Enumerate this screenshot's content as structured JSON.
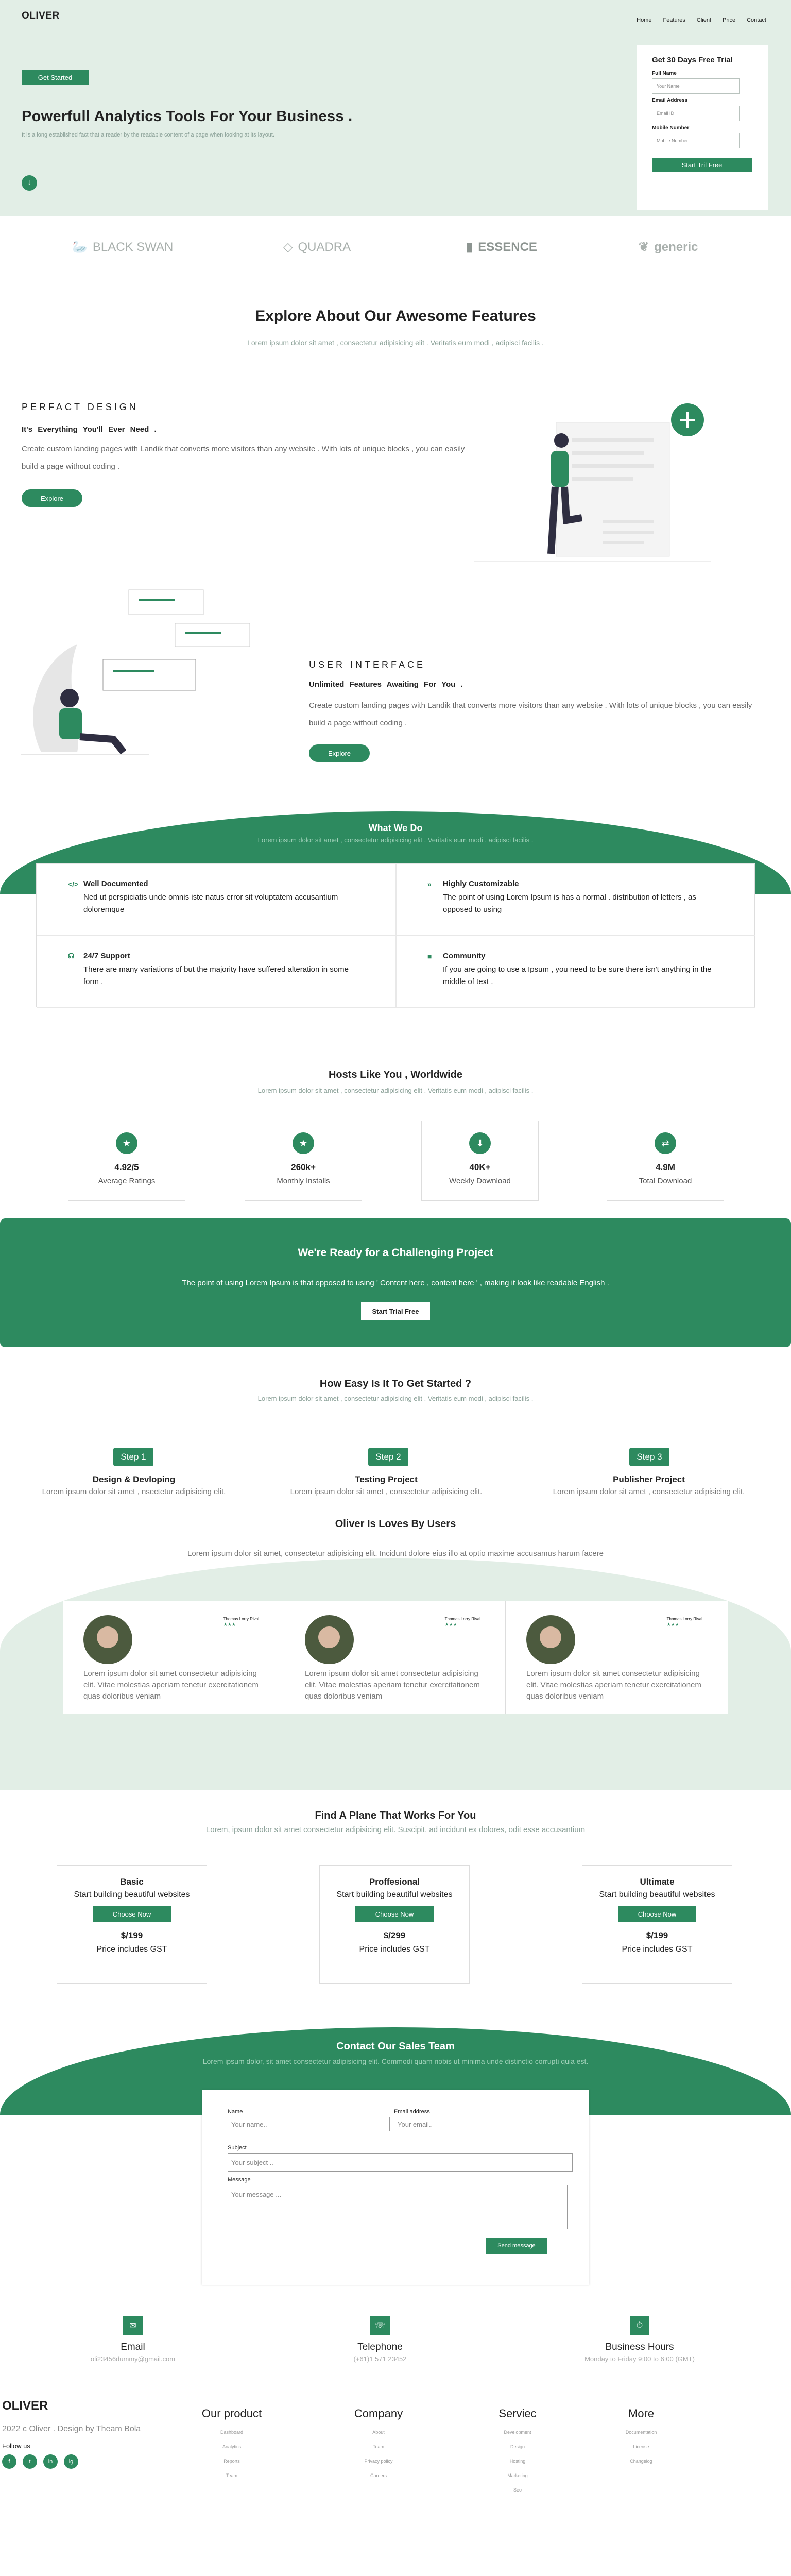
{
  "header": {
    "logo": "OLIVER",
    "nav": [
      "Home",
      "Features",
      "Client",
      "Price",
      "Contact"
    ]
  },
  "hero": {
    "cta": "Get Started",
    "title": "Powerfull Analytics Tools For Your Business .",
    "subtitle": "It is a long established fact that a reader by the readable content of a page when looking at its layout."
  },
  "trial": {
    "title": "Get 30 Days Free Trial",
    "name_label": "Full Name",
    "name_placeholder": "Your Name",
    "email_label": "Email Address",
    "email_placeholder": "Email ID",
    "phone_label": "Mobile Number",
    "phone_placeholder": "Mobile Number",
    "submit": "Start Tril Free"
  },
  "brands": [
    "BLACK SWAN",
    "QUADRA",
    "ESSENCE",
    "generic"
  ],
  "features": {
    "title": "Explore About Our Awesome Features",
    "subtitle": "Lorem ipsum dolor sit amet , consectetur adipisicing elit . Veritatis eum modi , adipisci facilis .",
    "block1": {
      "kicker": "PERFACT DESIGN",
      "bold": "It's Everything You'll Ever Need .",
      "body": "Create custom landing pages with Landik that converts more visitors than any website . With lots of unique blocks , you can easily build a page without coding .",
      "button": "Explore"
    },
    "block2": {
      "kicker": "USER INTERFACE",
      "bold": "Unlimited Features Awaiting For You .",
      "body": "Create custom landing pages with Landik that converts more visitors than any website . With lots of unique blocks , you can easily build a page without coding .",
      "button": "Explore"
    }
  },
  "what_we_do": {
    "title": "What We Do",
    "subtitle": "Lorem ipsum dolor sit amet , consectetur adipisicing elit . Veritatis eum modi , adipisci facilis .",
    "items": [
      {
        "icon": "code-icon",
        "title": "Well Documented",
        "body": "Ned ut perspiciatis unde omnis iste natus error sit voluptatem accusantium doloremque"
      },
      {
        "icon": "code-icon",
        "title": "Highly Customizable",
        "body": "The point of using Lorem Ipsum is has a normal . distribution of letters , as opposed to using"
      },
      {
        "icon": "headset-icon",
        "title": "24/7 Support",
        "body": "There are many variations of but the majority have suffered alteration in some form ."
      },
      {
        "icon": "chat-icon",
        "title": "Community",
        "body": "If you are going to use a Ipsum , you need to be sure there isn't anything in the middle of text ."
      }
    ]
  },
  "stats": {
    "title": "Hosts Like You , Worldwide",
    "subtitle": "Lorem ipsum dolor sit amet , consectetur adipisicing elit . Veritatis eum modi , adipisci facilis .",
    "items": [
      {
        "icon": "star-icon",
        "value": "4.92/5",
        "label": "Average Ratings"
      },
      {
        "icon": "star-icon",
        "value": "260k+",
        "label": "Monthly Installs"
      },
      {
        "icon": "download-icon",
        "value": "40K+",
        "label": "Weekly Download"
      },
      {
        "icon": "sync-icon",
        "value": "4.9M",
        "label": "Total Download"
      }
    ]
  },
  "ready": {
    "title": "We're Ready for a Challenging Project",
    "body": "The point of using Lorem Ipsum is that opposed to using ' Content here , content here ' , making it look like readable English .",
    "button": "Start Trial Free"
  },
  "steps": {
    "title": "How Easy Is It To Get Started ?",
    "subtitle": "Lorem ipsum dolor sit amet , consectetur adipisicing elit . Veritatis eum modi , adipisci facilis .",
    "items": [
      {
        "pill": "Step 1",
        "title": "Design & Devloping",
        "body": "Lorem ipsum dolor sit amet , nsectetur adipisicing elit."
      },
      {
        "pill": "Step 2",
        "title": "Testing Project",
        "body": "Lorem ipsum dolor sit amet , consectetur adipisicing elit."
      },
      {
        "pill": "Step 3",
        "title": "Publisher Project",
        "body": "Lorem ipsum dolor sit amet , consectetur adipisicing elit."
      }
    ]
  },
  "testimonials": {
    "title": "Oliver Is Loves By Users",
    "subtitle": "Lorem ipsum dolor sit amet, consectetur adipisicing elit. Incidunt dolore eius illo at optio maxime accusamus harum facere",
    "name": "Thomas Lorry Rival",
    "stars": "★★★",
    "body": "Lorem ipsum dolor sit amet consectetur adipisicing elit. Vitae molestias aperiam tenetur exercitationem quas doloribus veniam"
  },
  "pricing": {
    "title": "Find A Plane That Works For You",
    "subtitle": "Lorem, ipsum dolor sit amet consectetur adipisicing elit. Suscipit, ad incidunt ex dolores, odit esse accusantium",
    "plans": [
      {
        "name": "Basic",
        "tag": "Start building beautiful websites",
        "button": "Choose Now",
        "price": "$/199",
        "note": "Price includes GST"
      },
      {
        "name": "Proffesional",
        "tag": "Start building beautiful websites",
        "button": "Choose Now",
        "price": "$/299",
        "note": "Price includes GST"
      },
      {
        "name": "Ultimate",
        "tag": "Start building beautiful websites",
        "button": "Choose Now",
        "price": "$/199",
        "note": "Price includes GST"
      }
    ]
  },
  "contact": {
    "title": "Contact Our Sales Team",
    "subtitle": "Lorem ipsum dolor, sit amet consectetur adipisicing elit. Commodi quam nobis ut minima unde distinctio corrupti quia est.",
    "name_label": "Name",
    "name_placeholder": "Your name..",
    "email_label": "Email address",
    "email_placeholder": "Your email..",
    "subject_label": "Subject",
    "subject_placeholder": "Your subject ..",
    "message_label": "Message",
    "message_placeholder": "Your message ...",
    "submit": "Send message"
  },
  "info": [
    {
      "icon": "mail-icon",
      "title": "Email",
      "value": "oli23456dummy@gmail.com"
    },
    {
      "icon": "phone-icon",
      "title": "Telephone",
      "value": "(+61)1 571 23452"
    },
    {
      "icon": "clock-icon",
      "title": "Business Hours",
      "value": "Monday to Friday 9:00 to 6:00 (GMT)"
    }
  ],
  "footer": {
    "logo": "OLIVER",
    "copyright": "2022 c Oliver . Design by Theam Bola",
    "follow": "Follow us",
    "social": [
      "f",
      "t",
      "in",
      "ig"
    ],
    "columns": [
      {
        "title": "Our product",
        "links": [
          "Dashboard",
          "Analytics",
          "Reports",
          "Team"
        ]
      },
      {
        "title": "Company",
        "links": [
          "About",
          "Team",
          "Privacy policy",
          "Careers"
        ]
      },
      {
        "title": "Serviec",
        "links": [
          "Development",
          "Design",
          "Hosting",
          "Marketing",
          "Seo"
        ]
      },
      {
        "title": "More",
        "links": [
          "Documentation",
          "License",
          "Changelog"
        ]
      }
    ]
  },
  "colors": {
    "accent": "#2d8a5f",
    "light": "#e2eee6"
  }
}
